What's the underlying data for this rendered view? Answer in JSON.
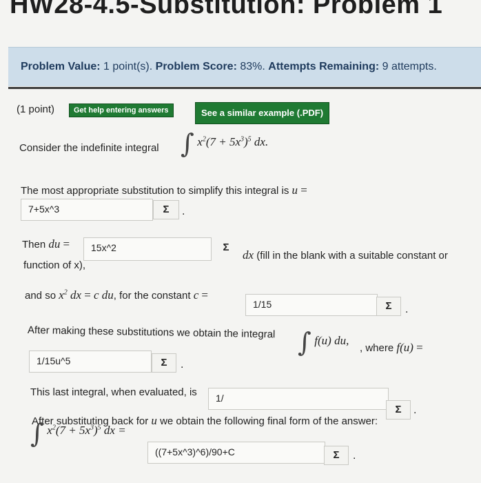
{
  "page_title": "HW28-4.5-Substitution: Problem 1",
  "info_bar": {
    "problem_value_label": "Problem Value:",
    "problem_value": "1 point(s).",
    "problem_score_label": "Problem Score:",
    "problem_score": "83%.",
    "attempts_label": "Attempts Remaining:",
    "attempts_value": "9 attempts."
  },
  "toolbar": {
    "points": "(1 point)",
    "help_button": "Get help entering answers",
    "example_button": "See a similar example (.PDF)"
  },
  "problem": {
    "intro": "Consider the indefinite integral",
    "substitution_prompt": "The most appropriate substitution to simplify this integral is",
    "du_prefix": "Then",
    "du_suffix": "(fill in the blank with a suitable constant or",
    "du_suffix_2": "function of x),",
    "const_prefix": "and so",
    "const_mid": ", for the constant",
    "after_prefix": "After making these substitutions we obtain the integral",
    "after_mid": ", where",
    "last_prompt": "This last integral, when evaluated, is",
    "back_prompt_pre": "After substituting back for",
    "back_prompt_post": "we obtain the following final form of the answer:"
  },
  "answers": {
    "u": "7+5x^3",
    "du": "15x^2",
    "c": "1/15",
    "f_u": "1/15u^5",
    "evaluated": "1/",
    "final": "((7+5x^3)^6)/90+C"
  },
  "sigma_label": "Σ",
  "colors": {
    "info_bar_bg": "#cdddea",
    "button_green": "#1f7a33"
  }
}
